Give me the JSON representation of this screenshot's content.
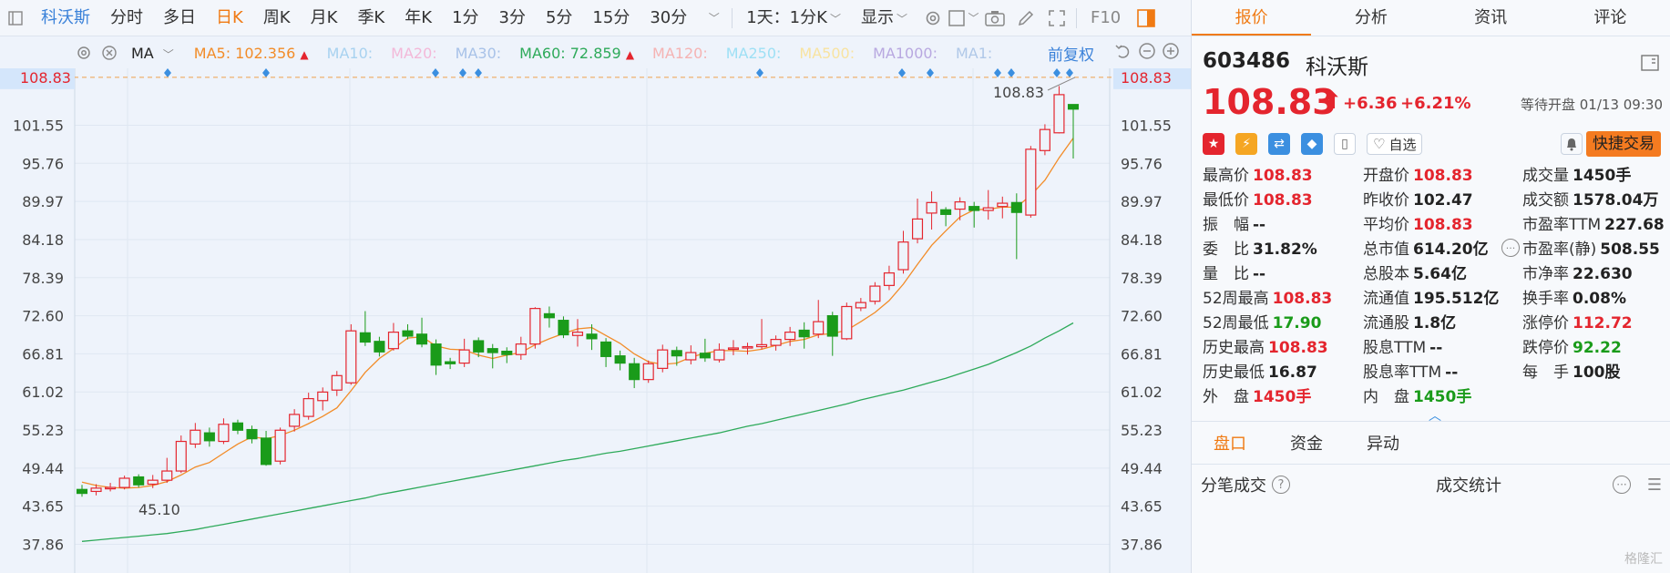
{
  "toolbar": {
    "items": [
      "科沃斯",
      "分时",
      "多日",
      "日K",
      "周K",
      "月K",
      "季K",
      "年K",
      "1分",
      "3分",
      "5分",
      "15分",
      "30分"
    ],
    "active_index": 3,
    "interval": "1天：1分K",
    "display": "显示",
    "f10": "F10"
  },
  "ma": {
    "label": "MA",
    "lines": [
      {
        "text": "MA5: 102.356",
        "color": "#f28c28",
        "arrow": "▲"
      },
      {
        "text": "MA10:",
        "color": "#a8d2f0"
      },
      {
        "text": "MA20:",
        "color": "#f3b8d8"
      },
      {
        "text": "MA30:",
        "color": "#a8c2e8"
      },
      {
        "text": "MA60: 72.859",
        "color": "#2eaa5a",
        "arrow": "▲"
      },
      {
        "text": "MA120:",
        "color": "#f5b3b3"
      },
      {
        "text": "MA250:",
        "color": "#9ee0f5"
      },
      {
        "text": "MA500:",
        "color": "#f8e3a0"
      },
      {
        "text": "MA1000:",
        "color": "#b8a8e0"
      },
      {
        "text": "MA1:",
        "color": "#b0c8e8"
      }
    ],
    "adjust": "前复权"
  },
  "chart_data": {
    "type": "candlestick",
    "y_ticks": [
      101.55,
      95.76,
      89.97,
      84.18,
      78.39,
      72.6,
      66.81,
      61.02,
      55.23,
      49.44,
      43.65,
      37.86
    ],
    "ylim": [
      33.5,
      110.2
    ],
    "last_price": 108.83,
    "last_price_label": "108.83",
    "max_label": "108.83",
    "min_label": "45.10",
    "candles": [
      [
        46.2,
        45.6,
        46.9,
        45.1
      ],
      [
        45.9,
        46.4,
        47.0,
        45.3
      ],
      [
        46.3,
        46.5,
        47.2,
        45.9
      ],
      [
        46.5,
        47.9,
        48.3,
        46.2
      ],
      [
        48.1,
        46.9,
        48.5,
        46.5
      ],
      [
        47.0,
        47.6,
        48.4,
        46.4
      ],
      [
        47.6,
        49.0,
        51.0,
        47.2
      ],
      [
        49.0,
        53.5,
        54.4,
        48.7
      ],
      [
        53.1,
        55.2,
        56.3,
        52.5
      ],
      [
        54.8,
        53.6,
        55.6,
        52.7
      ],
      [
        53.5,
        56.1,
        57.0,
        53.1
      ],
      [
        56.3,
        55.2,
        56.8,
        54.6
      ],
      [
        55.3,
        53.9,
        55.9,
        53.2
      ],
      [
        54.0,
        50.0,
        55.1,
        49.8
      ],
      [
        50.5,
        55.2,
        55.6,
        50.0
      ],
      [
        55.8,
        57.6,
        58.4,
        55.0
      ],
      [
        57.3,
        60.0,
        60.9,
        56.8
      ],
      [
        59.7,
        61.0,
        61.7,
        58.2
      ],
      [
        61.3,
        63.5,
        64.2,
        60.4
      ],
      [
        62.4,
        70.3,
        71.3,
        62.1
      ],
      [
        70.0,
        68.6,
        73.3,
        68.0
      ],
      [
        68.7,
        67.1,
        69.4,
        66.4
      ],
      [
        67.6,
        70.1,
        71.5,
        67.3
      ],
      [
        70.3,
        69.5,
        71.3,
        69.0
      ],
      [
        69.8,
        68.3,
        72.3,
        67.8
      ],
      [
        68.3,
        65.1,
        69.0,
        63.6
      ],
      [
        65.6,
        65.3,
        66.2,
        64.5
      ],
      [
        65.4,
        67.4,
        69.1,
        64.8
      ],
      [
        68.8,
        67.1,
        69.3,
        66.3
      ],
      [
        67.6,
        67.0,
        68.3,
        64.6
      ],
      [
        67.2,
        66.7,
        67.8,
        65.4
      ],
      [
        66.7,
        68.3,
        69.4,
        65.9
      ],
      [
        68.3,
        73.7,
        73.9,
        67.6
      ],
      [
        72.9,
        72.3,
        74.0,
        70.8
      ],
      [
        71.9,
        69.7,
        72.5,
        69.2
      ],
      [
        69.6,
        70.1,
        72.1,
        67.9
      ],
      [
        69.8,
        69.1,
        71.3,
        67.4
      ],
      [
        68.6,
        66.4,
        69.2,
        64.8
      ],
      [
        66.5,
        65.4,
        67.3,
        64.3
      ],
      [
        65.3,
        62.9,
        66.2,
        61.6
      ],
      [
        62.9,
        65.3,
        65.8,
        62.4
      ],
      [
        64.6,
        67.4,
        68.2,
        64.0
      ],
      [
        67.3,
        66.5,
        67.9,
        65.0
      ],
      [
        65.9,
        67.0,
        68.1,
        65.2
      ],
      [
        66.9,
        66.2,
        69.1,
        65.6
      ],
      [
        65.9,
        67.4,
        68.4,
        65.5
      ],
      [
        67.6,
        67.7,
        68.9,
        66.6
      ],
      [
        67.8,
        67.9,
        68.5,
        66.7
      ],
      [
        67.9,
        68.2,
        72.1,
        67.5
      ],
      [
        68.1,
        69.0,
        69.6,
        67.3
      ],
      [
        69.0,
        70.1,
        70.9,
        68.0
      ],
      [
        70.4,
        69.4,
        71.6,
        67.6
      ],
      [
        69.8,
        71.7,
        75.0,
        69.2
      ],
      [
        72.6,
        69.5,
        73.2,
        66.5
      ],
      [
        69.1,
        74.0,
        74.6,
        68.9
      ],
      [
        73.8,
        74.6,
        75.3,
        73.3
      ],
      [
        74.8,
        77.1,
        77.7,
        74.3
      ],
      [
        77.2,
        79.1,
        80.2,
        76.5
      ],
      [
        79.6,
        83.8,
        85.5,
        79.0
      ],
      [
        84.3,
        87.3,
        90.4,
        83.6
      ],
      [
        88.2,
        89.8,
        91.5,
        85.7
      ],
      [
        88.7,
        88.0,
        89.1,
        86.2
      ],
      [
        88.8,
        89.9,
        90.6,
        87.1
      ],
      [
        89.2,
        88.6,
        89.9,
        86.0
      ],
      [
        88.6,
        89.0,
        91.7,
        87.2
      ],
      [
        89.2,
        89.7,
        90.7,
        87.4
      ],
      [
        89.8,
        88.3,
        91.2,
        81.2
      ],
      [
        87.9,
        97.9,
        98.4,
        87.5
      ],
      [
        97.7,
        100.9,
        101.7,
        97.0
      ],
      [
        100.4,
        106.2,
        107.5,
        100.3
      ],
      [
        104.7,
        104.0,
        104.6,
        96.5
      ]
    ],
    "ma5": [
      47.3,
      46.8,
      46.5,
      46.4,
      46.5,
      46.8,
      47.4,
      48.4,
      49.6,
      50.3,
      51.7,
      53.1,
      54.2,
      53.9,
      54.4,
      55.2,
      56.2,
      57.3,
      58.6,
      61.2,
      64.0,
      66.1,
      67.6,
      69.2,
      69.4,
      68.0,
      67.5,
      67.4,
      66.6,
      66.1,
      66.6,
      67.0,
      68.2,
      69.1,
      69.9,
      70.6,
      70.8,
      69.6,
      68.4,
      66.8,
      65.6,
      65.2,
      65.4,
      66.3,
      66.9,
      67.3,
      67.3,
      67.2,
      67.5,
      68.1,
      68.7,
      69.0,
      69.7,
      69.9,
      70.4,
      71.7,
      73.1,
      74.9,
      77.4,
      80.4,
      83.3,
      85.5,
      87.6,
      88.7,
      88.8,
      89.1,
      89.1,
      90.9,
      93.2,
      96.6,
      99.6
    ],
    "ma60": [
      38.3,
      38.5,
      38.7,
      38.9,
      39.1,
      39.3,
      39.5,
      39.8,
      40.1,
      40.5,
      40.9,
      41.3,
      41.7,
      42.1,
      42.5,
      42.9,
      43.3,
      43.7,
      44.1,
      44.5,
      44.9,
      45.4,
      45.8,
      46.2,
      46.6,
      47.0,
      47.4,
      47.8,
      48.2,
      48.6,
      49.0,
      49.4,
      49.8,
      50.2,
      50.6,
      50.9,
      51.3,
      51.7,
      52.0,
      52.4,
      52.8,
      53.2,
      53.6,
      54.0,
      54.4,
      54.8,
      55.3,
      55.8,
      56.2,
      56.7,
      57.2,
      57.7,
      58.2,
      58.7,
      59.2,
      59.8,
      60.3,
      60.8,
      61.3,
      61.9,
      62.5,
      63.1,
      63.8,
      64.5,
      65.2,
      66.1,
      67.0,
      68.0,
      69.2,
      70.3,
      71.5
    ]
  },
  "quote": {
    "tabs": [
      "报价",
      "分析",
      "资讯",
      "评论"
    ],
    "code": "603486",
    "name": "科沃斯",
    "price": "108.83",
    "arrow": "⬆",
    "change": "+6.36",
    "change_pct": "+6.21%",
    "status": "等待开盘 01/13 09:30",
    "watchlist": "自选",
    "fast_trade": "快捷交易",
    "rows": [
      [
        [
          "最高价",
          "108.83",
          "red"
        ],
        [
          "开盘价",
          "108.83",
          "red"
        ],
        [
          "成交量",
          "1450手",
          "dark"
        ]
      ],
      [
        [
          "最低价",
          "108.83",
          "red"
        ],
        [
          "昨收价",
          "102.47",
          "dark"
        ],
        [
          "成交额",
          "1578.04万",
          "dark"
        ]
      ],
      [
        [
          "振　幅",
          "--",
          "dark"
        ],
        [
          "平均价",
          "108.83",
          "red"
        ],
        [
          "市盈率TTM",
          "227.68",
          "dark"
        ]
      ],
      [
        [
          "委　比",
          "31.82%",
          "dark"
        ],
        [
          "总市值",
          "614.20亿",
          "dark"
        ],
        [
          "市盈率(静)",
          "508.55",
          "dark"
        ]
      ],
      [
        [
          "量　比",
          "--",
          "dark"
        ],
        [
          "总股本",
          "5.64亿",
          "dark"
        ],
        [
          "市净率",
          "22.630",
          "dark"
        ]
      ],
      [
        [
          "52周最高",
          "108.83",
          "red"
        ],
        [
          "流通值",
          "195.512亿",
          "dark"
        ],
        [
          "换手率",
          "0.08%",
          "dark"
        ]
      ],
      [
        [
          "52周最低",
          "17.90",
          "green"
        ],
        [
          "流通股",
          "1.8亿",
          "dark"
        ],
        [
          "涨停价",
          "112.72",
          "red"
        ]
      ],
      [
        [
          "历史最高",
          "108.83",
          "red"
        ],
        [
          "股息TTM",
          "--",
          "dark"
        ],
        [
          "跌停价",
          "92.22",
          "green"
        ]
      ],
      [
        [
          "历史最低",
          "16.87",
          "dark"
        ],
        [
          "股息率TTM",
          "--",
          "dark"
        ],
        [
          "每　手",
          "100股",
          "dark"
        ]
      ],
      [
        [
          "外　盘",
          "1450手",
          "red"
        ],
        [
          "内　盘",
          "1450手",
          "green"
        ]
      ]
    ],
    "subtabs": [
      "盘口",
      "资金",
      "异动"
    ],
    "trades_label": "分笔成交",
    "trades_stats": "成交统计",
    "watermark": "格隆汇"
  }
}
